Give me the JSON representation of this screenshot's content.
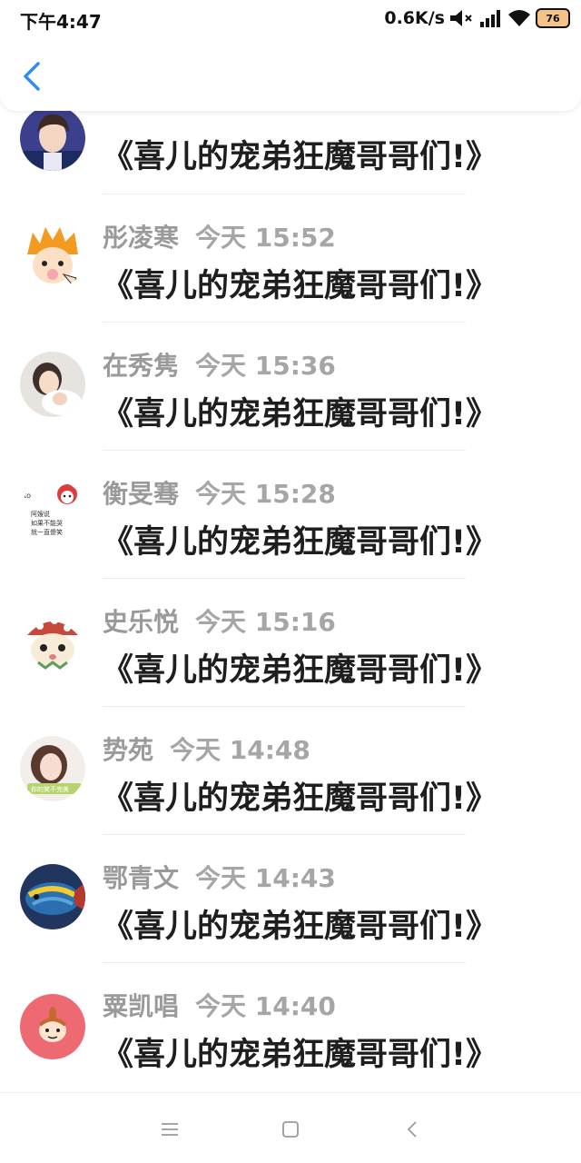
{
  "status_bar": {
    "time": "下午4:47",
    "net_speed": "0.6K/s",
    "icons": [
      "mute-icon",
      "signal-icon",
      "wifi-icon",
      "battery-icon"
    ],
    "battery_level": "76"
  },
  "header": {
    "back_icon": "chevron-left-icon",
    "accent_color": "#2f8df0"
  },
  "items": [
    {
      "name": "",
      "time": "",
      "title": "《喜儿的宠弟狂魔哥哥们!》",
      "avatar": "avatar-boy-photo"
    },
    {
      "name": "彤凌寒",
      "time": "今天 15:52",
      "title": "《喜儿的宠弟狂魔哥哥们!》",
      "avatar": "avatar-anime-orange-hair"
    },
    {
      "name": "在秀隽",
      "time": "今天 15:36",
      "title": "《喜儿的宠弟狂魔哥哥们!》",
      "avatar": "avatar-girl-photo"
    },
    {
      "name": "衡旻骞",
      "time": "今天 15:28",
      "title": "《喜儿的宠弟狂魔哥哥们!》",
      "avatar": "avatar-text-sticker",
      "avatar_text": [
        "阿嫂说",
        "如果不能哭",
        "就一直傻笑"
      ]
    },
    {
      "name": "史乐悦",
      "time": "今天 15:16",
      "title": "《喜儿的宠弟狂魔哥哥们!》",
      "avatar": "avatar-hamster-cartoon"
    },
    {
      "name": "势苑",
      "time": "今天 14:48",
      "title": "《喜儿的宠弟狂魔哥哥们!》",
      "avatar": "avatar-woman-photo",
      "avatar_text": [
        "你的笑不完美"
      ]
    },
    {
      "name": "鄂青文",
      "time": "今天 14:43",
      "title": "《喜儿的宠弟狂魔哥哥们!》",
      "avatar": "avatar-fish-photo"
    },
    {
      "name": "粟凯唱",
      "time": "今天 14:40",
      "title": "《喜儿的宠弟狂魔哥哥们!》",
      "avatar": "avatar-little-my-cartoon"
    }
  ],
  "nav_bar": {
    "icons": [
      "menu-icon",
      "home-square-icon",
      "back-triangle-icon"
    ]
  }
}
